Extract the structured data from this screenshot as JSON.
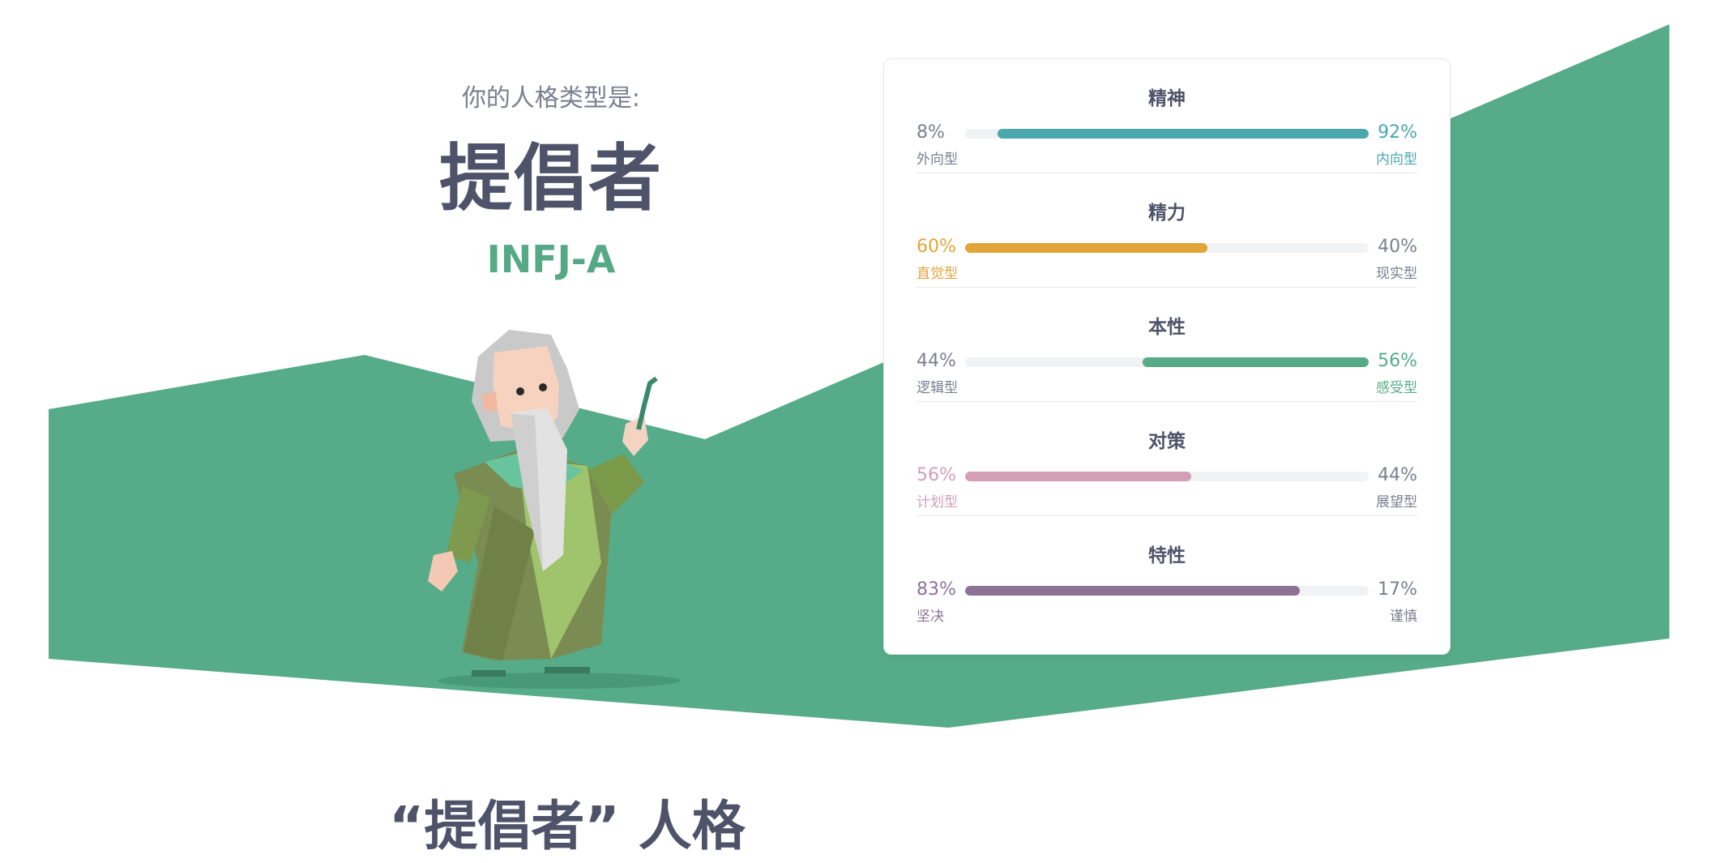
{
  "intro": {
    "prefix": "你的人格类型是:",
    "type_name": "提倡者",
    "type_code": "INFJ-A"
  },
  "colors": {
    "band_green": "#56ab88",
    "mind": "#4aa8ad",
    "energy": "#e3a43a",
    "nature": "#56ab88",
    "tactics": "#d29fb5",
    "identity": "#8c7396",
    "text_dark": "#4e5369",
    "text_muted": "#7b7f90"
  },
  "traits": [
    {
      "title": "精神",
      "left_pct": "8%",
      "right_pct": "92%",
      "left_label": "外向型",
      "right_label": "内向型",
      "dominant": "right",
      "fill_fraction": 0.92,
      "color": "#4aa8ad"
    },
    {
      "title": "精力",
      "left_pct": "60%",
      "right_pct": "40%",
      "left_label": "直觉型",
      "right_label": "现实型",
      "dominant": "left",
      "fill_fraction": 0.6,
      "color": "#e3a43a"
    },
    {
      "title": "本性",
      "left_pct": "44%",
      "right_pct": "56%",
      "left_label": "逻辑型",
      "right_label": "感受型",
      "dominant": "right",
      "fill_fraction": 0.56,
      "color": "#56ab88"
    },
    {
      "title": "对策",
      "left_pct": "56%",
      "right_pct": "44%",
      "left_label": "计划型",
      "right_label": "展望型",
      "dominant": "left",
      "fill_fraction": 0.56,
      "color": "#d29fb5"
    },
    {
      "title": "特性",
      "left_pct": "83%",
      "right_pct": "17%",
      "left_label": "坚决",
      "right_label": "谨慎",
      "dominant": "left",
      "fill_fraction": 0.83,
      "color": "#8c7396"
    }
  ],
  "section": {
    "title": "“提倡者” 人格"
  },
  "illustration": {
    "icon": "sage-character-icon"
  }
}
